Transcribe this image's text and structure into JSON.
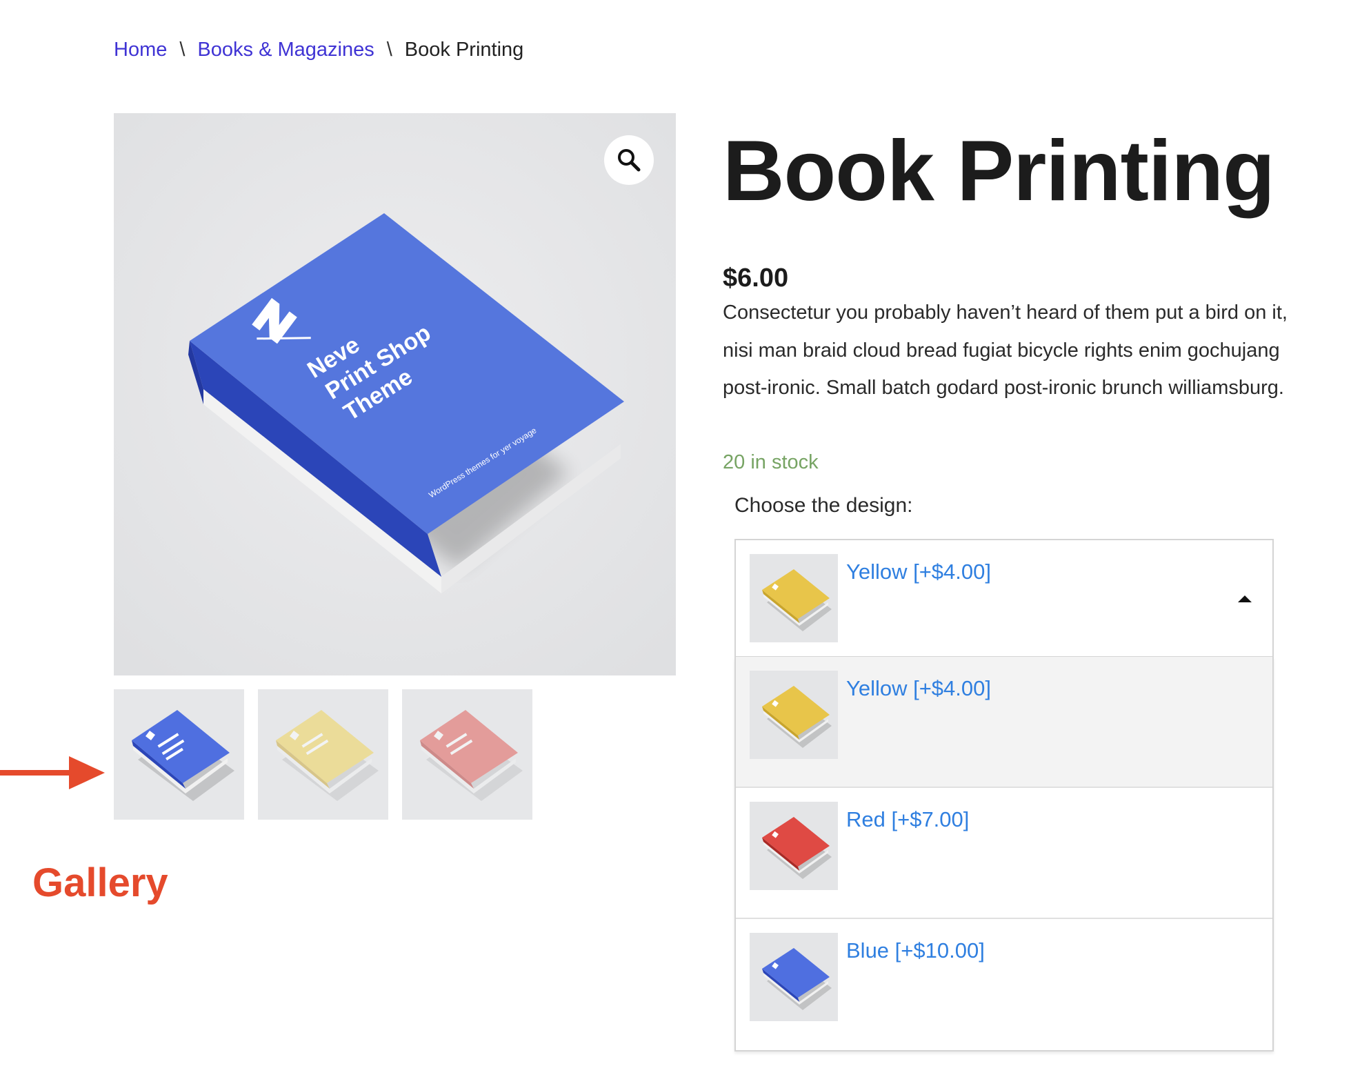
{
  "breadcrumb": {
    "home": "Home",
    "separator": "\\",
    "category": "Books & Magazines",
    "current": "Book Printing"
  },
  "product": {
    "title": "Book Printing",
    "price": "$6.00",
    "description": "Consectetur you probably haven’t heard of them put a bird on it, nisi man braid cloud bread fugiat bicycle rights enim gochujang post-ironic. Small batch godard post-ironic brunch williamsburg.",
    "stock": "20 in stock",
    "cover_title_line1": "Neve",
    "cover_title_line2": "Print Shop",
    "cover_title_line3": "Theme",
    "cover_tagline": "WordPress themes for yer voyage"
  },
  "gallery": {
    "thumbnails": [
      {
        "color": "blue",
        "selected": true
      },
      {
        "color": "yellow",
        "selected": false
      },
      {
        "color": "red",
        "selected": false
      }
    ],
    "annotation_label": "Gallery"
  },
  "variation": {
    "label": "Choose the design:",
    "selected": "Yellow [+$4.00]",
    "options": [
      {
        "label": "Yellow [+$4.00]",
        "color": "yellow"
      },
      {
        "label": "Red [+$7.00]",
        "color": "red"
      },
      {
        "label": "Blue [+$10.00]",
        "color": "blue"
      }
    ]
  },
  "colors": {
    "link": "#3f33d4",
    "option_text": "#2f7fe0",
    "stock": "#77a464",
    "annotation": "#e54a2c",
    "book_blue": "#4f6fe0",
    "book_yellow": "#e8c54a",
    "book_red": "#df4a44"
  },
  "icons": {
    "zoom": "magnifier-icon",
    "caret": "caret-up-icon",
    "arrow": "arrow-right-icon"
  }
}
